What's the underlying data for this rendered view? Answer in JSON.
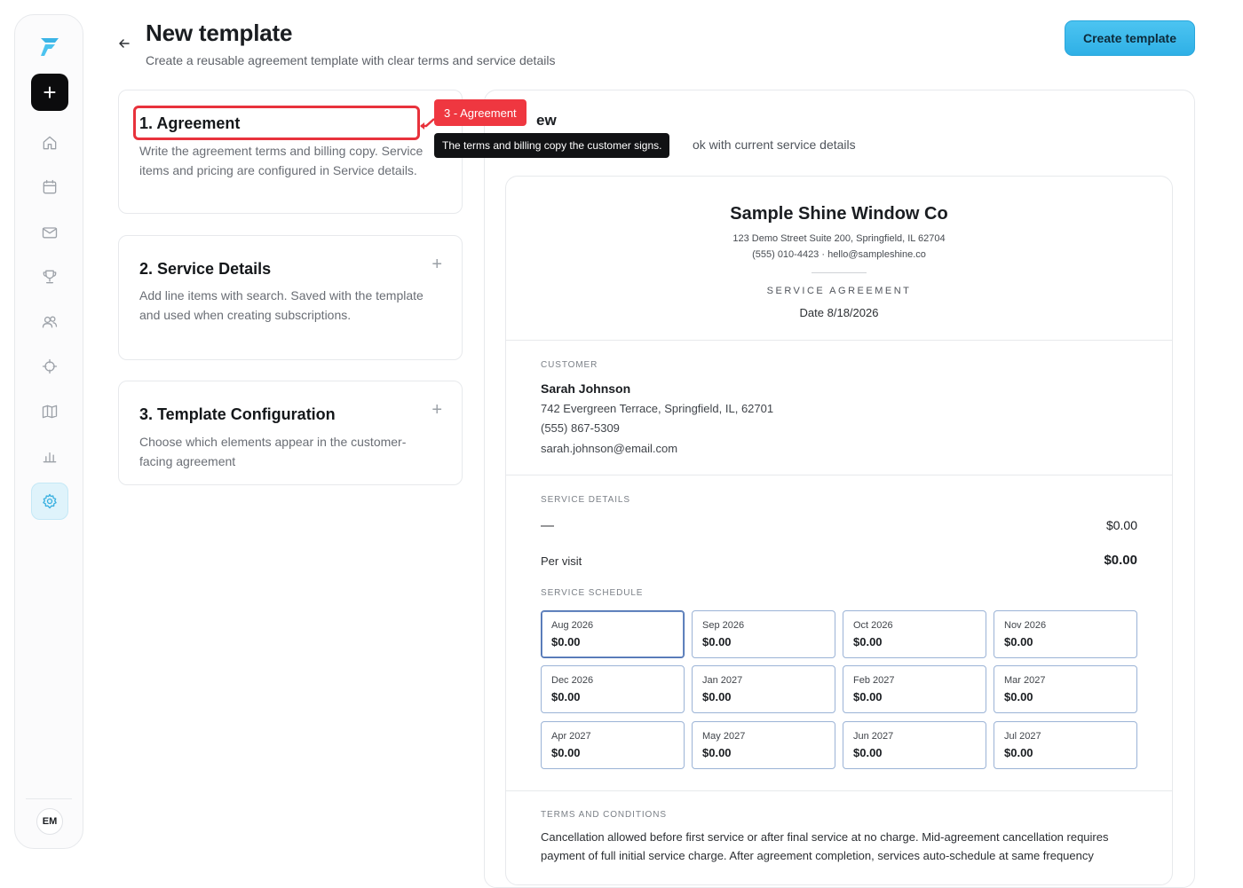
{
  "sidebar": {
    "logo_icon": "brand-logo",
    "new_button_icon": "plus-icon",
    "items": [
      {
        "icon": "home-icon"
      },
      {
        "icon": "calendar-icon"
      },
      {
        "icon": "mail-icon"
      },
      {
        "icon": "trophy-icon"
      },
      {
        "icon": "users-icon"
      },
      {
        "icon": "target-icon"
      },
      {
        "icon": "map-icon"
      },
      {
        "icon": "bar-chart-icon"
      },
      {
        "icon": "settings-icon",
        "active": true
      }
    ],
    "avatar_initials": "EM"
  },
  "header": {
    "title": "New template",
    "subtitle": "Create a reusable agreement template with clear terms and service details",
    "create_button": "Create template"
  },
  "steps": [
    {
      "title": "1. Agreement",
      "description": "Write the agreement terms and billing copy. Service items and pricing are configured in Service details."
    },
    {
      "title": "2. Service Details",
      "description": "Add line items with search. Saved with the template and used when creating subscriptions.",
      "expand": "+"
    },
    {
      "title": "3. Template Configuration",
      "description": "Choose which elements appear in the customer-facing agreement",
      "expand": "+"
    }
  ],
  "annotation": {
    "tag": "3 - Agreement",
    "tooltip": "The terms and billing copy the customer signs."
  },
  "preview": {
    "title_visible": "ew",
    "subtitle_visible": "ok with current service details"
  },
  "document": {
    "company": "Sample Shine Window Co",
    "address": "123 Demo Street Suite 200, Springfield, IL 62704",
    "contact": "(555) 010-4423 · hello@sampleshine.co",
    "agreement_label": "SERVICE AGREEMENT",
    "date": "Date 8/18/2026",
    "customer_label": "CUSTOMER",
    "customer": {
      "name": "Sarah Johnson",
      "address": "742 Evergreen Terrace, Springfield, IL, 62701",
      "phone": "(555) 867-5309",
      "email": "sarah.johnson@email.com"
    },
    "service_details_label": "SERVICE DETAILS",
    "line_item": {
      "name": "—",
      "price": "$0.00"
    },
    "per_visit": {
      "label": "Per visit",
      "price": "$0.00"
    },
    "schedule_label": "SERVICE SCHEDULE",
    "schedule": [
      {
        "month": "Aug 2026",
        "amount": "$0.00"
      },
      {
        "month": "Sep 2026",
        "amount": "$0.00"
      },
      {
        "month": "Oct 2026",
        "amount": "$0.00"
      },
      {
        "month": "Nov 2026",
        "amount": "$0.00"
      },
      {
        "month": "Dec 2026",
        "amount": "$0.00"
      },
      {
        "month": "Jan 2027",
        "amount": "$0.00"
      },
      {
        "month": "Feb 2027",
        "amount": "$0.00"
      },
      {
        "month": "Mar 2027",
        "amount": "$0.00"
      },
      {
        "month": "Apr 2027",
        "amount": "$0.00"
      },
      {
        "month": "May 2027",
        "amount": "$0.00"
      },
      {
        "month": "Jun 2027",
        "amount": "$0.00"
      },
      {
        "month": "Jul 2027",
        "amount": "$0.00"
      }
    ],
    "terms_label": "TERMS AND CONDITIONS",
    "terms": "Cancellation allowed before first service or after final service at no charge. Mid-agreement cancellation requires payment of full initial service charge. After agreement completion, services auto-schedule at same frequency"
  },
  "colors": {
    "accent": "#2fb0e6",
    "highlight": "#e8323c",
    "tooltip_bg": "#111214"
  }
}
